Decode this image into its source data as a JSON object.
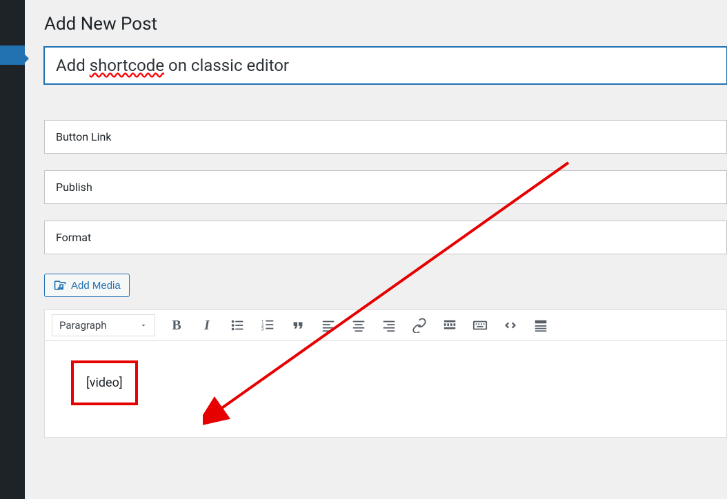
{
  "page": {
    "title": "Add New Post"
  },
  "title_input": {
    "prefix": "Add ",
    "spellcheck_word": "shortcode",
    "suffix": " on classic editor"
  },
  "meta_boxes": [
    {
      "label": "Button Link"
    },
    {
      "label": "Publish"
    },
    {
      "label": "Format"
    }
  ],
  "add_media": {
    "label": "Add Media"
  },
  "toolbar": {
    "format_select": "Paragraph"
  },
  "content": {
    "shortcode": "[video]"
  }
}
